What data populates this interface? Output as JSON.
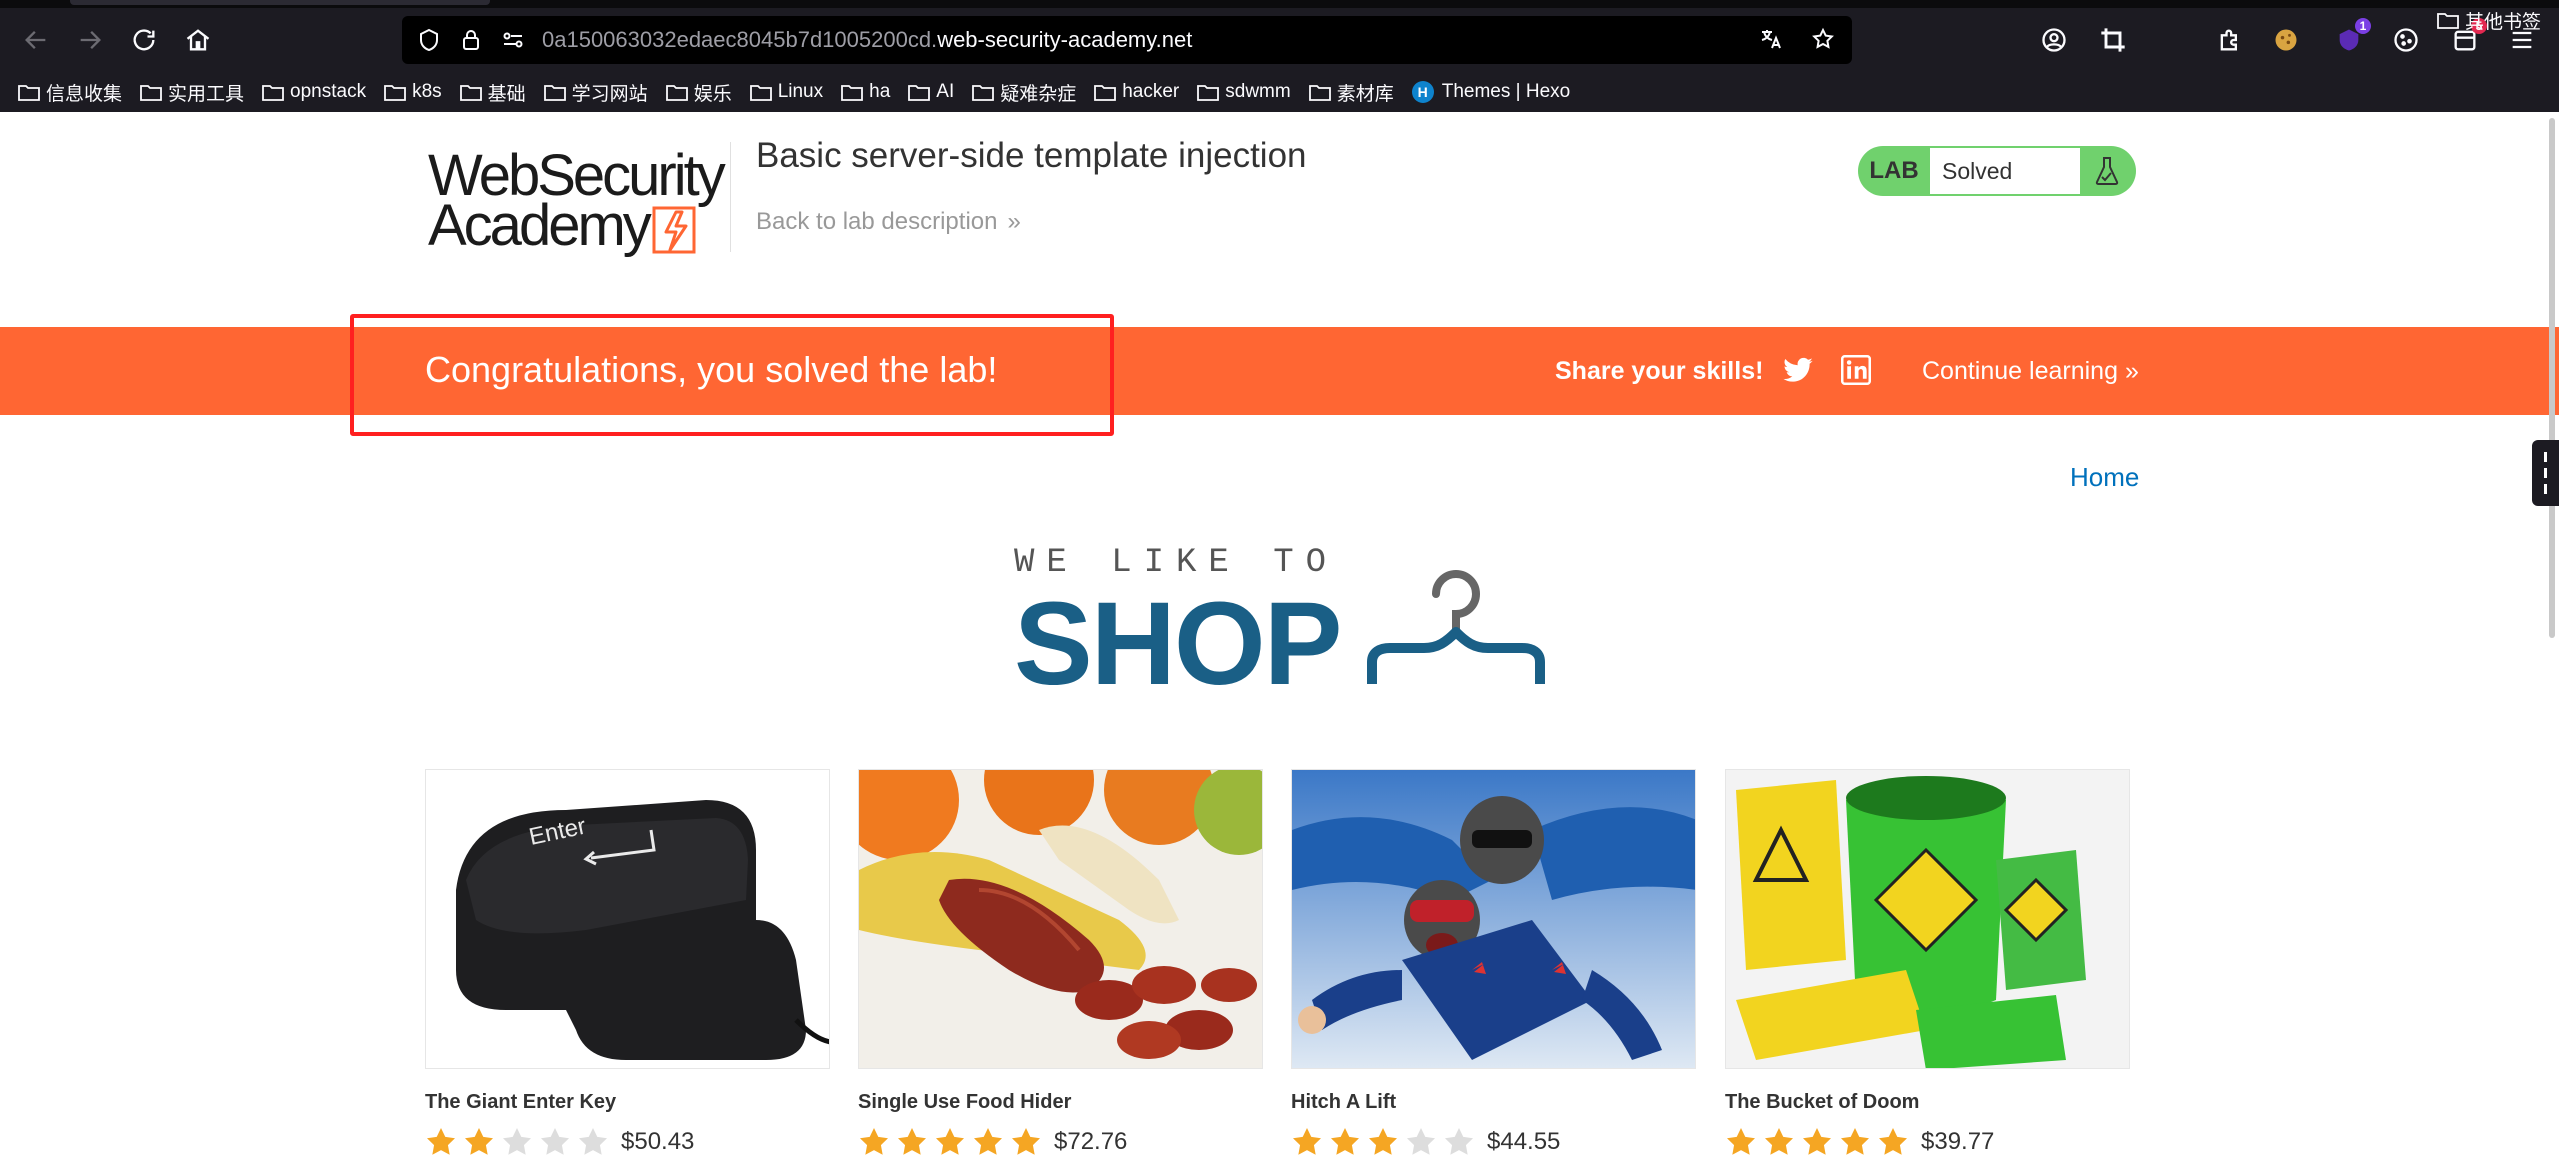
{
  "browser": {
    "url_host_prefix": "0a150063032edaec8045b7d1005200cd.",
    "url_domain": "web-security-academy.net",
    "extensions_badges": {
      "purple": "1",
      "red": "5"
    },
    "bookmarks": [
      {
        "label": "信息收集"
      },
      {
        "label": "实用工具"
      },
      {
        "label": "opnstack"
      },
      {
        "label": "k8s"
      },
      {
        "label": "基础"
      },
      {
        "label": "学习网站"
      },
      {
        "label": "娱乐"
      },
      {
        "label": "Linux"
      },
      {
        "label": "ha"
      },
      {
        "label": "AI"
      },
      {
        "label": "疑难杂症"
      },
      {
        "label": "hacker"
      },
      {
        "label": "sdwmm"
      },
      {
        "label": "素材库"
      }
    ],
    "bookmark_hexo": "Themes | Hexo",
    "bookmark_other": "其他书签"
  },
  "header": {
    "logo_line1": "WebSecurity",
    "logo_line2": "Academy",
    "lab_title": "Basic server-side template injection",
    "back_link": "Back to lab description",
    "lab_tag": "LAB",
    "lab_status": "Solved"
  },
  "banner": {
    "message": "Congratulations, you solved the lab!",
    "share": "Share your skills!",
    "continue": "Continue learning"
  },
  "nav": {
    "home": "Home"
  },
  "shop_logo": {
    "small": "WE LIKE TO",
    "big": "SHOP"
  },
  "products": [
    {
      "name": "The Giant Enter Key",
      "rating": 2,
      "price": "$50.43",
      "image": "enter-key"
    },
    {
      "name": "Single Use Food Hider",
      "rating": 5,
      "price": "$72.76",
      "image": "food-hider"
    },
    {
      "name": "Hitch A Lift",
      "rating": 3,
      "price": "$44.55",
      "image": "skydivers"
    },
    {
      "name": "The Bucket of Doom",
      "rating": 5,
      "price": "$39.77",
      "image": "bucket-of-doom"
    }
  ],
  "colors": {
    "banner": "#ff6633",
    "lab_solved": "#70d16d",
    "shop_blue": "#1a5f86",
    "link": "#0071bc",
    "star_on": "#f5a623",
    "star_off": "#dddddd"
  }
}
